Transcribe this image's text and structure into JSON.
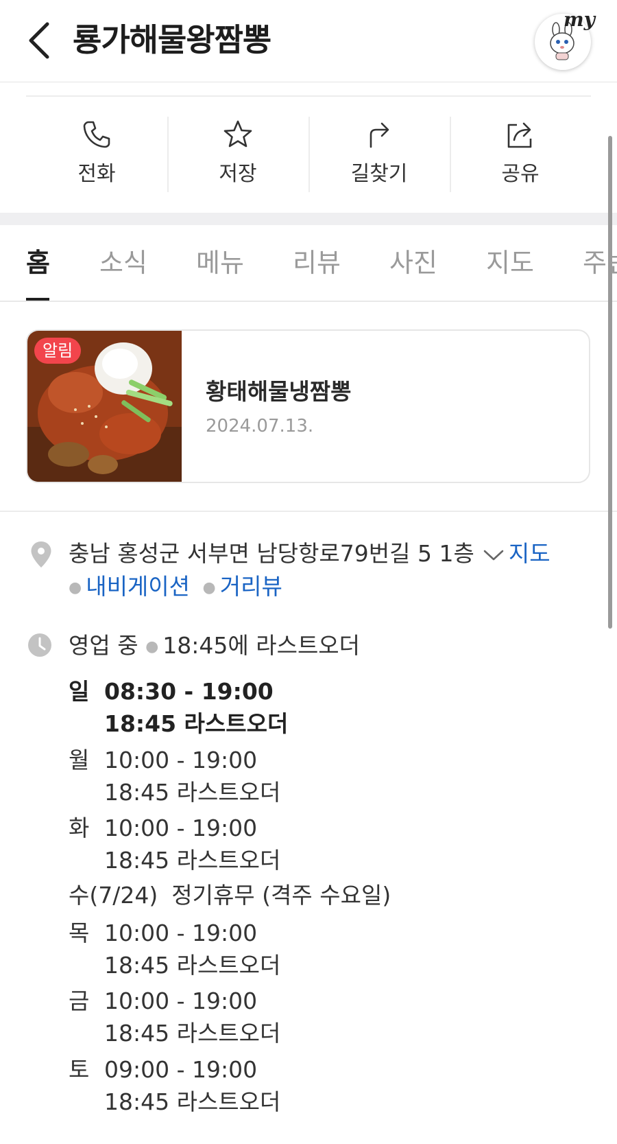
{
  "header": {
    "title": "룡가해물왕짬뽕",
    "avatar_text": "my"
  },
  "actions": [
    {
      "label": "전화",
      "icon": "phone-icon"
    },
    {
      "label": "저장",
      "icon": "star-icon"
    },
    {
      "label": "길찾기",
      "icon": "directions-icon"
    },
    {
      "label": "공유",
      "icon": "share-icon"
    }
  ],
  "tabs": [
    {
      "label": "홈",
      "active": true
    },
    {
      "label": "소식"
    },
    {
      "label": "메뉴"
    },
    {
      "label": "리뷰"
    },
    {
      "label": "사진"
    },
    {
      "label": "지도"
    },
    {
      "label": "주변"
    }
  ],
  "notice": {
    "badge": "알림",
    "title": "황태해물냉짬뽕",
    "date": "2024.07.13."
  },
  "address": {
    "text": "충남 홍성군 서부면 남당항로79번길 5 1층",
    "link_map": "지도",
    "link_navigation": "내비게이션",
    "link_streetview": "거리뷰"
  },
  "status": {
    "open": "영업 중",
    "last_order": "18:45에 라스트오더"
  },
  "hours": [
    {
      "day": "일",
      "time": "08:30 - 19:00",
      "last_order": "18:45 라스트오더",
      "today": true
    },
    {
      "day": "월",
      "time": "10:00 - 19:00",
      "last_order": "18:45 라스트오더"
    },
    {
      "day": "화",
      "time": "10:00 - 19:00",
      "last_order": "18:45 라스트오더"
    },
    {
      "day": "수(7/24)",
      "time": "정기휴무 (격주 수요일)",
      "closed": true
    },
    {
      "day": "목",
      "time": "10:00 - 19:00",
      "last_order": "18:45 라스트오더"
    },
    {
      "day": "금",
      "time": "10:00 - 19:00",
      "last_order": "18:45 라스트오더"
    },
    {
      "day": "토",
      "time": "09:00 - 19:00",
      "last_order": "18:45 라스트오더"
    }
  ],
  "colors": {
    "link": "#1a64c4",
    "badge": "#f2454c",
    "active_tab": "#1f1f1f",
    "inactive_tab": "#9a9a9a"
  }
}
